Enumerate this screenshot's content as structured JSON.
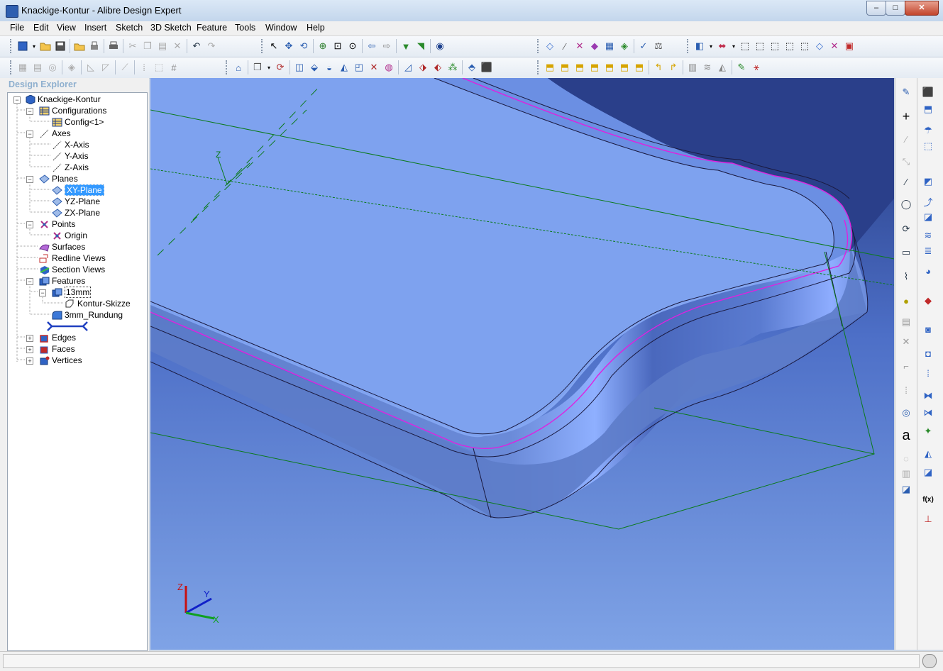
{
  "window": {
    "title": "Knackige-Kontur - Alibre Design Expert",
    "minimize": "–",
    "maximize": "□",
    "close": "✕"
  },
  "menu": [
    "File",
    "Edit",
    "View",
    "Insert",
    "Sketch",
    "3D Sketch",
    "Feature",
    "Tools",
    "Window",
    "Help"
  ],
  "explorer": {
    "title": "Design Explorer",
    "root": "Knackige-Kontur",
    "configurations": "Configurations",
    "config1": "Config<1>",
    "axes": "Axes",
    "x_axis": "X-Axis",
    "y_axis": "Y-Axis",
    "z_axis": "Z-Axis",
    "planes": "Planes",
    "xy_plane": "XY-Plane",
    "yz_plane": "YZ-Plane",
    "zx_plane": "ZX-Plane",
    "points": "Points",
    "origin": "Origin",
    "surfaces": "Surfaces",
    "redline_views": "Redline Views",
    "section_views": "Section Views",
    "features": "Features",
    "feature_13mm": "13mm",
    "kontur_skizze": "Kontur-Skizze",
    "rundung": "3mm_Rundung",
    "edges": "Edges",
    "faces": "Faces",
    "vertices": "Vertices"
  },
  "triad": {
    "x": "X",
    "y": "Y",
    "z": "Z"
  },
  "sketch_bar": {
    "text_tool": "a",
    "function_tool": "f(x)"
  },
  "colors": {
    "viewport_top": "#21357a",
    "viewport_bottom": "#7fa3e6",
    "part_face": "#7ea2ef",
    "highlight_edge": "#e020e0",
    "plane_line": "#0b7a1b"
  }
}
